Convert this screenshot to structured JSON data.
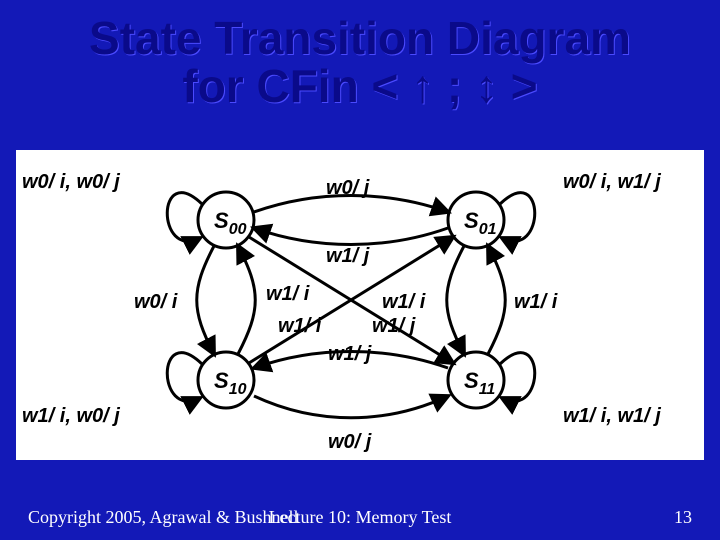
{
  "title": "State Transition Diagram\nfor CFin < ↑ ; ↕ >",
  "states": {
    "s00": "S",
    "s00_sub": "00",
    "s01": "S",
    "s01_sub": "01",
    "s10": "S",
    "s10_sub": "10",
    "s11": "S",
    "s11_sub": "11"
  },
  "labels": {
    "s00_self": "w0/ i, w0/ j",
    "s01_self": "w0/ i, w1/ j",
    "s10_self": "w1/ i, w0/ j",
    "s11_self": "w1/ i, w1/ j",
    "s00_to_s01": "w0/ j",
    "s01_to_s00": "w1/ j",
    "s00_to_s10": "w0/ i",
    "s10_to_s00": "w1/ i",
    "s01_to_s11": "w1/ i",
    "s11_to_s01": "w1/ i",
    "s10_to_s11": "w0/ j",
    "s11_to_s10": "w1/ j",
    "s00_to_s11": "w1/ j",
    "s10_to_s01": "w1/ i"
  },
  "footer": {
    "copyright": "Copyright 2005, Agrawal & Bushnell",
    "lecture": "Lecture 10: Memory Test",
    "page": "13"
  },
  "colors": {
    "background": "#1319b7",
    "title": "#0a0a8a",
    "footer": "#ffffff"
  },
  "chart_data": {
    "type": "state-transition-diagram",
    "states": [
      "S00",
      "S01",
      "S10",
      "S11"
    ],
    "transitions": [
      {
        "from": "S00",
        "to": "S00",
        "label": "w0/ i, w0/ j"
      },
      {
        "from": "S01",
        "to": "S01",
        "label": "w0/ i, w1/ j"
      },
      {
        "from": "S10",
        "to": "S10",
        "label": "w1/ i, w0/ j"
      },
      {
        "from": "S11",
        "to": "S11",
        "label": "w1/ i, w1/ j"
      },
      {
        "from": "S00",
        "to": "S01",
        "label": "w0/ j"
      },
      {
        "from": "S01",
        "to": "S00",
        "label": "w1/ j"
      },
      {
        "from": "S00",
        "to": "S10",
        "label": "w0/ i"
      },
      {
        "from": "S10",
        "to": "S00",
        "label": "w1/ i"
      },
      {
        "from": "S01",
        "to": "S11",
        "label": "w1/ i"
      },
      {
        "from": "S11",
        "to": "S01",
        "label": "w1/ i"
      },
      {
        "from": "S10",
        "to": "S11",
        "label": "w0/ j"
      },
      {
        "from": "S11",
        "to": "S10",
        "label": "w1/ j"
      },
      {
        "from": "S00",
        "to": "S11",
        "label": "w1/ j"
      },
      {
        "from": "S10",
        "to": "S01",
        "label": "w1/ i"
      }
    ]
  }
}
